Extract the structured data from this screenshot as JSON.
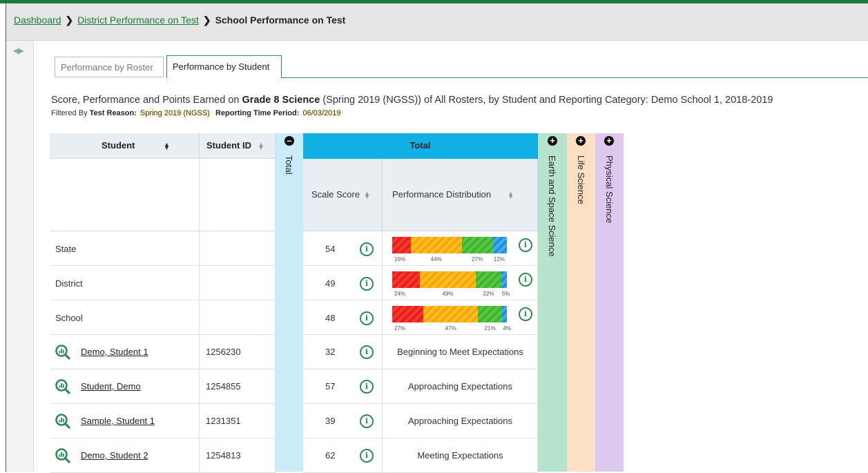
{
  "breadcrumb": {
    "items": [
      "Dashboard",
      "District Performance on Test"
    ],
    "current": "School Performance on Test"
  },
  "tabs": [
    {
      "label": "Performance by Roster",
      "active": false
    },
    {
      "label": "Performance by Student",
      "active": true
    }
  ],
  "title": {
    "prefix": "Score, Performance and Points Earned on ",
    "test": "Grade 8 Science",
    "suffix": " (Spring 2019 (NGSS)) of All Rosters, by Student and Reporting Category: Demo School 1, 2018-2019"
  },
  "filter": {
    "label": "Filtered By",
    "reason_label": "Test Reason:",
    "reason_value": "Spring 2019 (NGSS)",
    "period_label": "Reporting Time Period:",
    "period_value": "06/03/2019"
  },
  "table": {
    "col_student": "Student",
    "col_student_id": "Student ID",
    "total_group": "Total",
    "total_collapsed": "Total",
    "col_scale_score": "Scale Score",
    "col_perf_dist": "Performance Distribution",
    "categories": [
      "Earth and Space Science",
      "Life Science",
      "Physical Science"
    ],
    "colors": {
      "total_band": "#c9ecf8",
      "total_header": "#11b1e6",
      "earth": "#b5e3cb",
      "life": "#fde0c4",
      "physical": "#ddc8f0"
    },
    "summary_rows": [
      {
        "label": "State",
        "score": "54",
        "dist": [
          16,
          44,
          27,
          12
        ],
        "dist_labels": [
          "16%",
          "44%",
          "27%",
          "12%"
        ]
      },
      {
        "label": "District",
        "score": "49",
        "dist": [
          24,
          49,
          22,
          5
        ],
        "dist_labels": [
          "24%",
          "49%",
          "22%",
          "5%"
        ]
      },
      {
        "label": "School",
        "score": "48",
        "dist": [
          27,
          47,
          21,
          4
        ],
        "dist_labels": [
          "27%",
          "47%",
          "21%",
          "4%"
        ]
      }
    ],
    "students": [
      {
        "name": "Demo, Student 1",
        "id": "1256230",
        "score": "32",
        "level": "Beginning to Meet Expectations"
      },
      {
        "name": "Student, Demo",
        "id": "1254855",
        "score": "57",
        "level": "Approaching Expectations"
      },
      {
        "name": "Sample, Student 1",
        "id": "1231351",
        "score": "39",
        "level": "Approaching Expectations"
      },
      {
        "name": "Demo, Student 2",
        "id": "1254813",
        "score": "62",
        "level": "Meeting Expectations"
      }
    ]
  }
}
